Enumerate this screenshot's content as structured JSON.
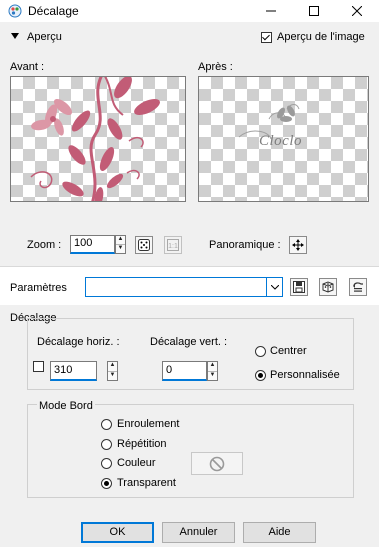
{
  "window": {
    "title": "Décalage"
  },
  "preview": {
    "toggle_label": "Aperçu",
    "image_preview_label": "Aperçu de l'image",
    "image_preview_checked": true,
    "before_label": "Avant :",
    "after_label": "Après :",
    "watermark_text": "Cloclo",
    "zoom_label": "Zoom :",
    "zoom_value": "100",
    "pan_label": "Panoramique :"
  },
  "params": {
    "label": "Paramètres",
    "value": ""
  },
  "offset": {
    "group_title": "Décalage",
    "horiz_label": "Décalage horiz. :",
    "horiz_value": "310",
    "vert_label": "Décalage vert. :",
    "vert_value": "0",
    "center_label": "Centrer",
    "custom_label": "Personnalisée",
    "selected": "custom"
  },
  "edge": {
    "group_title": "Mode Bord",
    "options": [
      "Enroulement",
      "Répétition",
      "Couleur",
      "Transparent"
    ],
    "selected": "Transparent"
  },
  "buttons": {
    "ok": "OK",
    "cancel": "Annuler",
    "help": "Aide"
  },
  "colors": {
    "accent": "#0078d7",
    "flower": "#c25c76",
    "flower_light": "#dc97a6"
  }
}
